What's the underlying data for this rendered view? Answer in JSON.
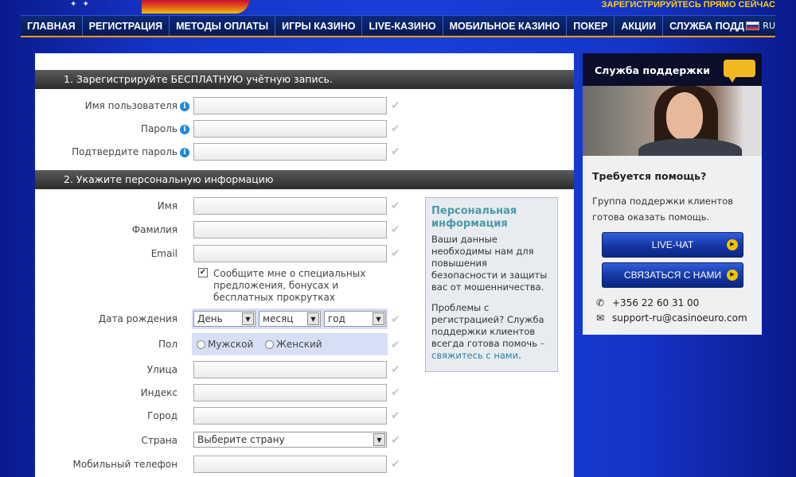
{
  "header": {
    "logo_mark": "✦ ✦",
    "register_now": "ЗАРЕГИСТРИРУЙТЕСЬ ПРЯМО СЕЙЧАС"
  },
  "nav": {
    "items": [
      "ГЛАВНАЯ",
      "РЕГИСТРАЦИЯ",
      "МЕТОДЫ ОПЛАТЫ",
      "ИГРЫ КАЗИНО",
      "LIVE-КАЗИНО",
      "МОБИЛЬНОЕ КАЗИНО",
      "ПОКЕР",
      "АКЦИИ",
      "СЛУЖБА ПОДДЕРЖКИ"
    ],
    "lang": "RU"
  },
  "form": {
    "section1_title": "1. Зарегистрируйте БЕСПЛАТНУЮ учётную запись.",
    "username_label": "Имя пользователя",
    "password_label": "Пароль",
    "confirm_password_label": "Подтвердите пароль",
    "section2_title": "2. Укажите персональную информацию",
    "first_name_label": "Имя",
    "last_name_label": "Фамилия",
    "email_label": "Email",
    "newsletter_text": "Сообщите мне о специальных предложения, бонусах и бесплатных прокрутках",
    "newsletter_checked": true,
    "dob_label": "Дата рождения",
    "dob_day": "День",
    "dob_month": "месяц",
    "dob_year": "год",
    "gender_label": "Пол",
    "gender_male": "Мужской",
    "gender_female": "Женский",
    "street_label": "Улица",
    "zip_label": "Индекс",
    "city_label": "Город",
    "country_label": "Страна",
    "country_value": "Выберите страну",
    "mobile_label": "Мобильный телефон"
  },
  "info_box": {
    "title": "Персональная информация",
    "text1": "Ваши данные необходимы нам для повышения безопасности и защиты вас от мошенничества.",
    "text2": "Проблемы с регистрацией? Служба поддержки клиентов всегда готова помочь",
    "link": "– свяжитесь с нами",
    "link_suffix": "."
  },
  "support": {
    "title": "Служба поддержки",
    "help_title": "Требуется помощь?",
    "help_text": "Группа поддержки клиентов готова оказать помощь.",
    "live_chat": "LIVE-ЧАТ",
    "contact_us": "СВЯЗАТЬСЯ С НАМИ",
    "phone": "+356 22 60 31 00",
    "email": "support-ru@casinoeuro.com"
  },
  "colors": {
    "accent": "#ff9d00",
    "nav_bg": "#061a55",
    "check": "#c7c7c7",
    "info_title": "#4a9aa8"
  }
}
